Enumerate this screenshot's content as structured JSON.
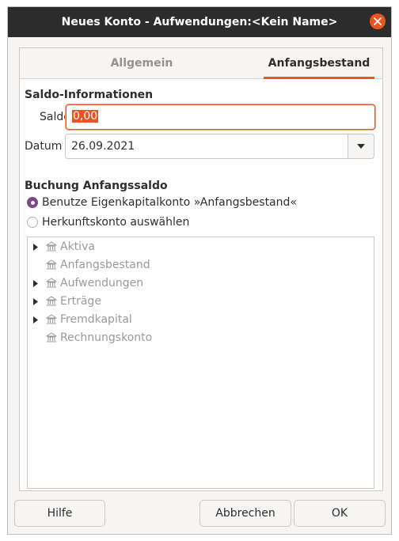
{
  "window": {
    "title": "Neues Konto - Aufwendungen:<Kein Name>"
  },
  "tabs": [
    {
      "label": "Allgemein",
      "active": false
    },
    {
      "label": "Anfangsbestand",
      "active": true
    }
  ],
  "balance": {
    "section_title": "Saldo-Informationen",
    "saldo_label": "Saldo",
    "saldo_value": "0,00",
    "datum_label": "Datum",
    "datum_value": "26.09.2021"
  },
  "transaction": {
    "section_title": "Buchung Anfangssaldo",
    "option_equity": "Benutze Eigenkapitalkonto »Anfangsbestand«",
    "option_transfer": "Herkunftskonto auswählen",
    "selected": "equity"
  },
  "tree": {
    "items": [
      {
        "label": "Aktiva",
        "expandable": true
      },
      {
        "label": "Anfangsbestand",
        "expandable": false
      },
      {
        "label": "Aufwendungen",
        "expandable": true
      },
      {
        "label": "Erträge",
        "expandable": true
      },
      {
        "label": "Fremdkapital",
        "expandable": true
      },
      {
        "label": "Rechnungskonto",
        "expandable": false
      }
    ]
  },
  "footer": {
    "help": "Hilfe",
    "cancel": "Abbrechen",
    "ok": "OK"
  },
  "colors": {
    "accent": "#e95420",
    "radio_checked": "#7d4a86",
    "titlebar": "#2c2c2c"
  }
}
